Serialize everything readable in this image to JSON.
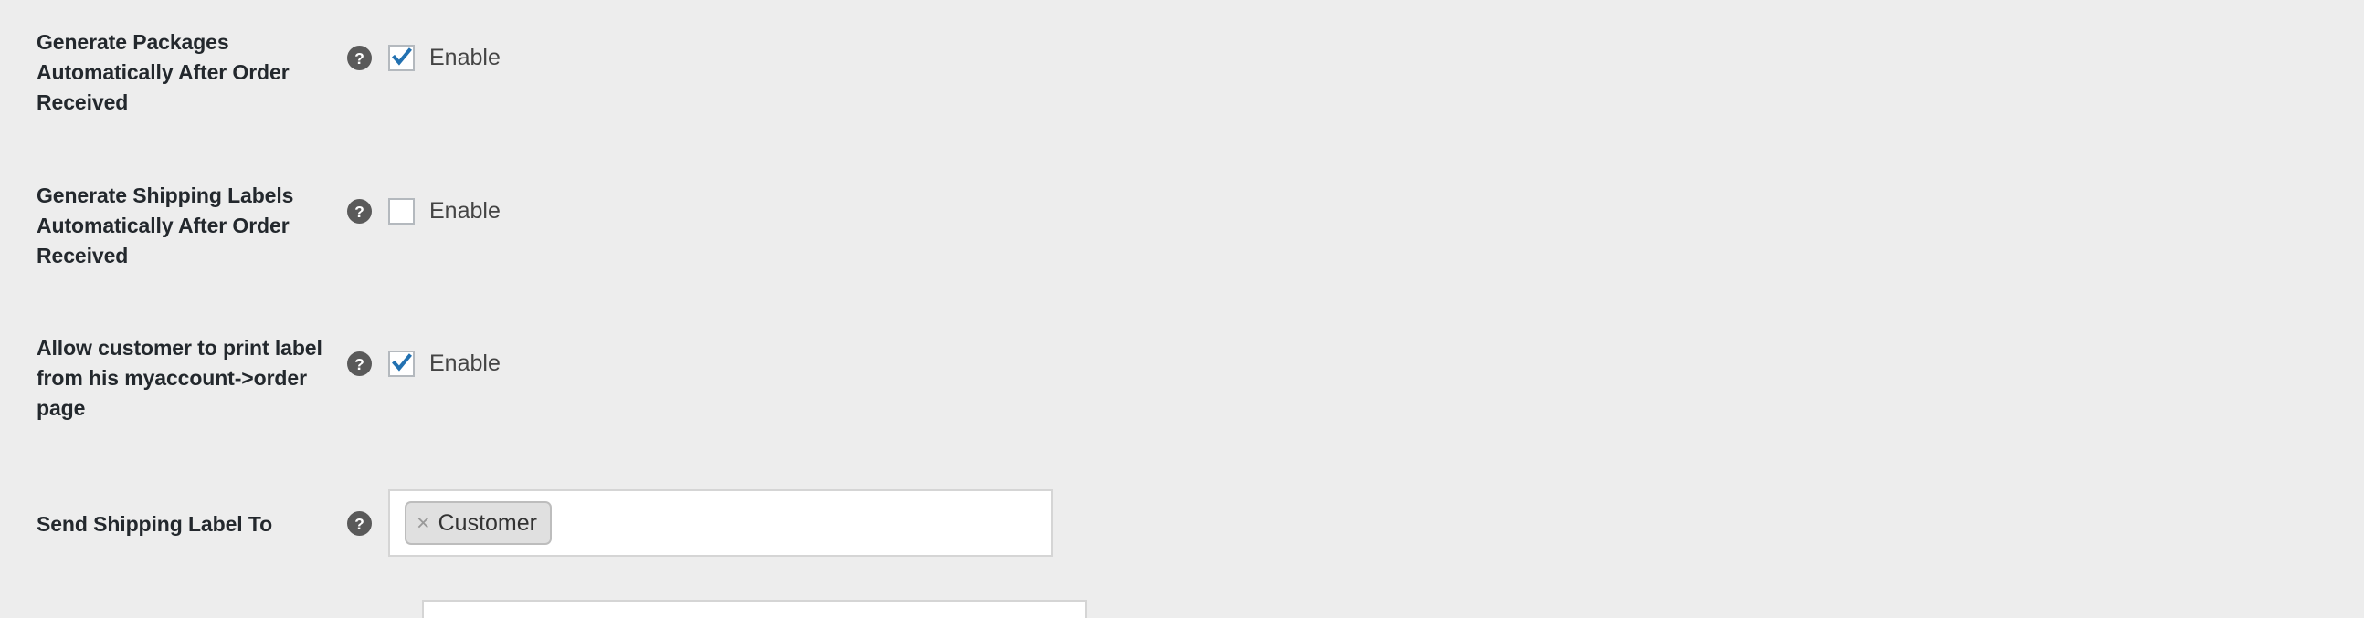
{
  "page": {
    "background_color": "#ededed",
    "label_color": "#23282d",
    "checkbox_accent_color": "#2271b1",
    "help_icon_color": "#5a5a5a"
  },
  "fields": [
    {
      "label": "Generate Packages Automatically After Order Received",
      "help_icon": "help-question-icon",
      "control_type": "checkbox",
      "checked": true,
      "checkbox_label": "Enable"
    },
    {
      "label": "Generate Shipping Labels Automatically After Order Received",
      "help_icon": "help-question-icon",
      "control_type": "checkbox",
      "checked": false,
      "checkbox_label": "Enable"
    },
    {
      "label": "Allow customer to print label from his myaccount->order page",
      "help_icon": "help-question-icon",
      "control_type": "checkbox",
      "checked": true,
      "checkbox_label": "Enable"
    },
    {
      "label": "Send Shipping Label To",
      "help_icon": "help-question-icon",
      "control_type": "multiselect",
      "selected_tags": [
        {
          "text": "Customer",
          "remove_glyph": "×"
        }
      ]
    }
  ]
}
